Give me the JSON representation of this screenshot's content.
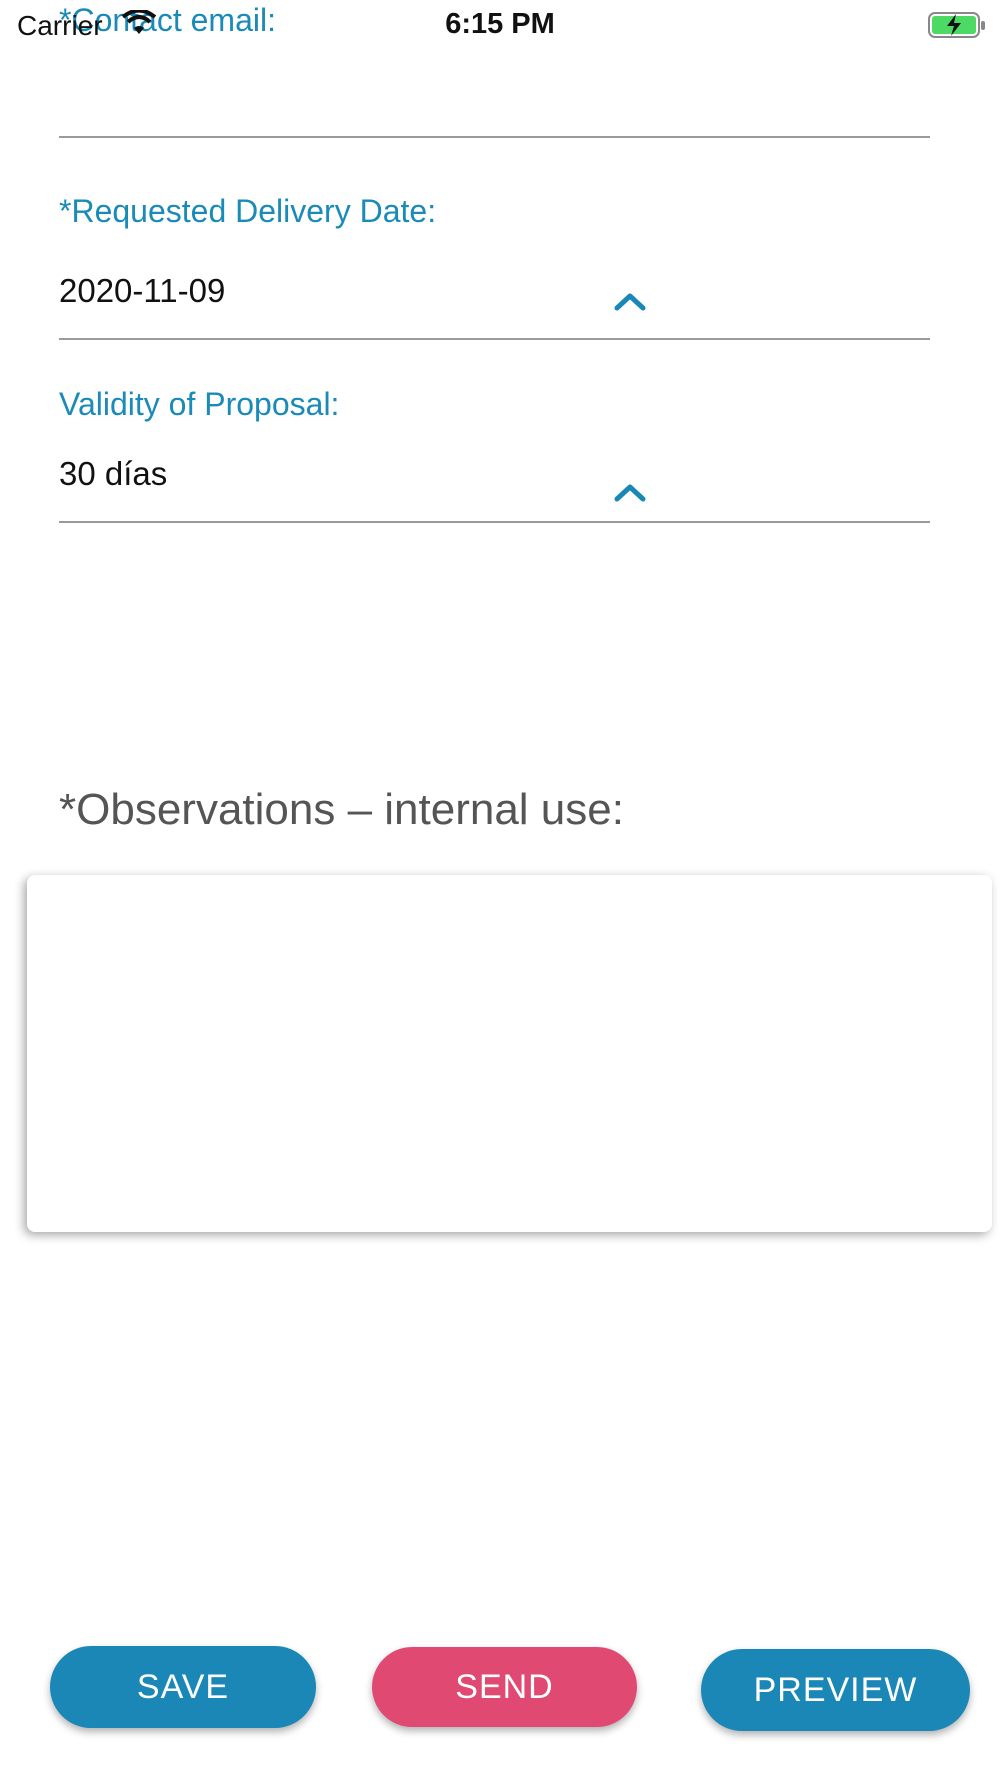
{
  "status_bar": {
    "carrier": "Carrier",
    "time": "6:15 PM"
  },
  "form": {
    "contact_email": {
      "label": "*Contact email:",
      "value": ""
    },
    "delivery_date": {
      "label": "*Requested Delivery Date:",
      "value": "2020-11-09"
    },
    "validity": {
      "label": "Validity of Proposal:",
      "value": "30 días"
    },
    "observations": {
      "heading": "*Observations – internal use:",
      "value": ""
    }
  },
  "buttons": {
    "save": "SAVE",
    "send": "SEND",
    "preview": "PREVIEW"
  },
  "colors": {
    "accent_blue": "#1a87b6",
    "send_pink": "#e04a72",
    "label_blue": "#1a8ab8",
    "battery_green": "#4cd964"
  },
  "icons": {
    "wifi": "wifi-icon",
    "battery": "battery-charging-icon",
    "dropdown": "chevron-up-icon"
  }
}
